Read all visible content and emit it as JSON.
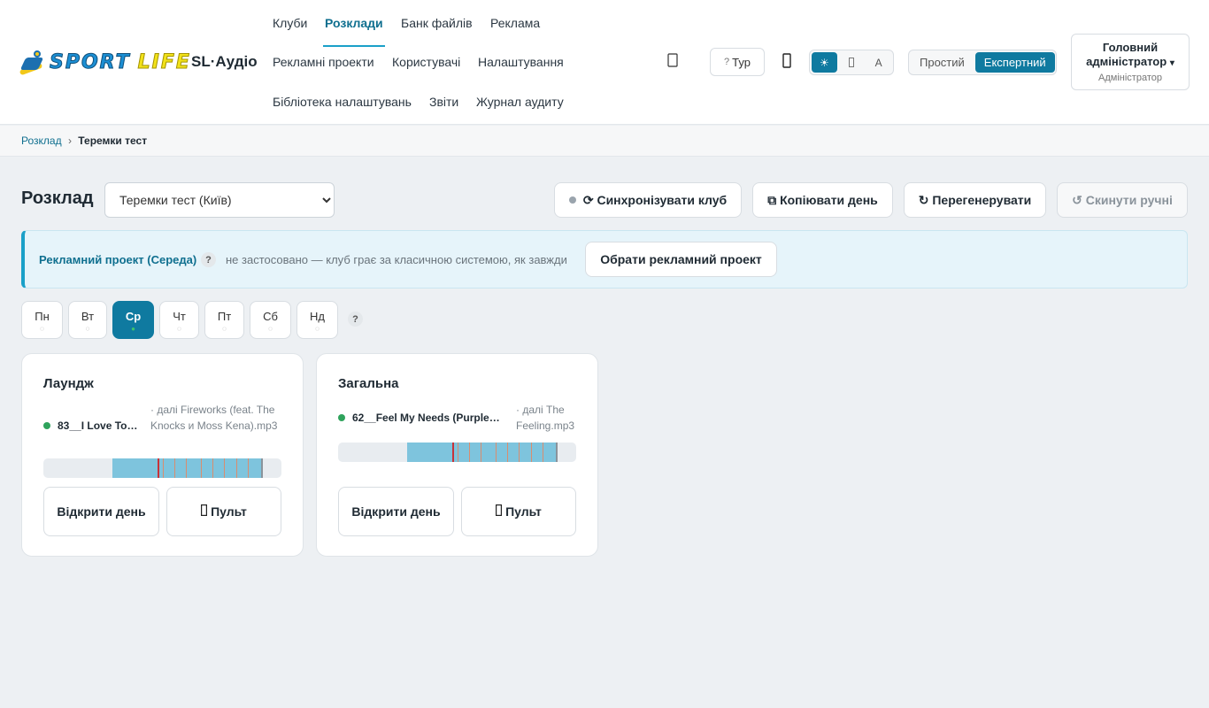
{
  "brand": {
    "logo_word1": "SPORT",
    "logo_word2": "LIFE",
    "app_name": "SL·Аудіо"
  },
  "nav": {
    "items": [
      {
        "label": "Клуби"
      },
      {
        "label": "Розклади",
        "active": true
      },
      {
        "label": "Банк файлів"
      },
      {
        "label": "Реклама"
      },
      {
        "label": "Рекламні проекти"
      },
      {
        "label": "Користувачі"
      },
      {
        "label": "Налаштування"
      },
      {
        "label": "Бібліотека налаштувань"
      },
      {
        "label": "Звіти"
      },
      {
        "label": "Журнал аудиту"
      }
    ]
  },
  "header": {
    "notification_icon": "bell-icon",
    "tour_label": "Тур",
    "tour_icon": "help-icon",
    "device_icon": "phone-icon",
    "theme_options": [
      {
        "label": "☀",
        "name": "light-theme-icon",
        "selected": true
      },
      {
        "label": "",
        "name": "dark-theme-icon",
        "selected": false
      },
      {
        "label": "A",
        "name": "auto-theme",
        "selected": false
      }
    ],
    "mode_options": [
      {
        "label": "Простий",
        "selected": false
      },
      {
        "label": "Експертний",
        "selected": true
      }
    ],
    "user": {
      "name": "Головний адміністратор",
      "caret": "▾",
      "role": "Адміністратор"
    }
  },
  "breadcrumb": {
    "root": "Розклад",
    "separator": "›",
    "current": "Теремки тест"
  },
  "toolbar": {
    "title": "Розклад",
    "club_selected": "Теремки тест (Київ)",
    "sync_label": "⟳ Синхронізувати клуб",
    "copy_label": "⧉ Копіювати день",
    "regen_label": "↻ Перегенерувати",
    "reset_label": "↺ Скинути ручні"
  },
  "ad_banner": {
    "title": "Рекламний проект (Середа)",
    "help": "?",
    "text": "не застосовано — клуб грає за класичною системою, як завжди",
    "button": "Обрати рекламний проект"
  },
  "days": [
    {
      "label": "Пн",
      "mark": "◌",
      "selected": false
    },
    {
      "label": "Вт",
      "mark": "◌",
      "selected": false
    },
    {
      "label": "Ср",
      "mark": "●",
      "selected": true
    },
    {
      "label": "Чт",
      "mark": "◌",
      "selected": false
    },
    {
      "label": "Пт",
      "mark": "◌",
      "selected": false
    },
    {
      "label": "Сб",
      "mark": "◌",
      "selected": false
    },
    {
      "label": "Нд",
      "mark": "◌",
      "selected": false
    }
  ],
  "days_help": "?",
  "zones": [
    {
      "title": "Лаундж",
      "now_playing": "83__I Love To…",
      "next": "· далі Fireworks (feat. The Knocks и Moss Kena).mp3",
      "timeline": {
        "fill_start": 0.29,
        "fill_end": 0.92,
        "now": 0.48,
        "ticks": [
          0.5,
          0.55,
          0.6,
          0.66,
          0.71,
          0.76,
          0.81,
          0.86
        ]
      },
      "open_day_label": "Відкрити день",
      "remote_label": "Пульт",
      "remote_icon": "remote-icon"
    },
    {
      "title": "Загальна",
      "now_playing": "62__Feel My Needs (Purple…",
      "next": "· далі The Feeling.mp3",
      "timeline": {
        "fill_start": 0.29,
        "fill_end": 0.92,
        "now": 0.48,
        "ticks": [
          0.5,
          0.55,
          0.6,
          0.66,
          0.71,
          0.76,
          0.81,
          0.86
        ]
      },
      "open_day_label": "Відкрити день",
      "remote_label": "Пульт",
      "remote_icon": "remote-icon"
    }
  ]
}
